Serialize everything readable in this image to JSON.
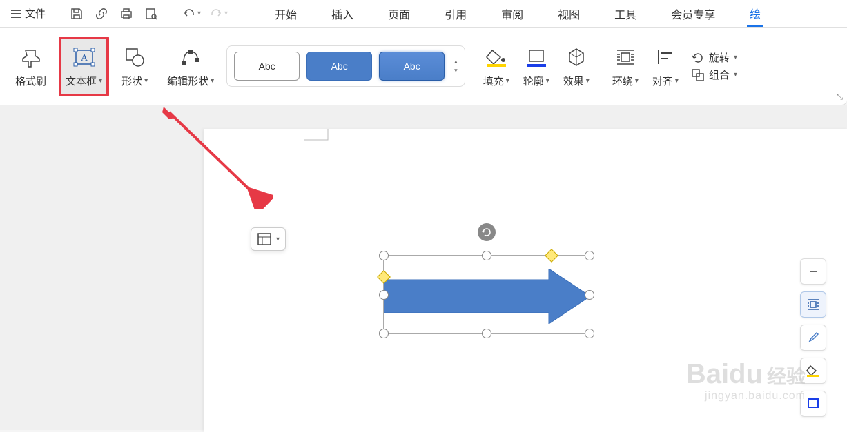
{
  "topbar": {
    "file": "文件"
  },
  "tabs": {
    "start": "开始",
    "insert": "插入",
    "page": "页面",
    "reference": "引用",
    "review": "审阅",
    "view": "视图",
    "tools": "工具",
    "member": "会员专享",
    "draw": "绘"
  },
  "ribbon": {
    "format_painter": "格式刷",
    "text_box": "文本框",
    "shape": "形状",
    "edit_shape": "编辑形状",
    "style_label": "Abc",
    "fill": "填充",
    "outline": "轮廓",
    "effects": "效果",
    "wrap": "环绕",
    "align": "对齐",
    "rotate": "旋转",
    "group": "组合"
  },
  "watermark": {
    "brand": "Baidu",
    "cn": "经验",
    "url": "jingyan.baidu.com"
  }
}
